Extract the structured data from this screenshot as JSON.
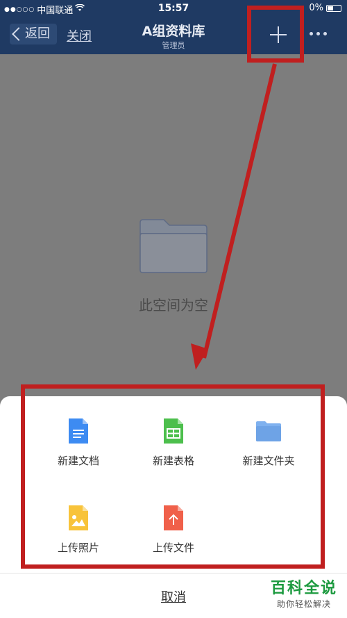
{
  "status_bar": {
    "carrier": "中国联通",
    "time": "15:57",
    "battery": "0%"
  },
  "nav": {
    "back_label": "返回",
    "close_label": "关闭",
    "title": "A组资料库",
    "subtitle": "管理员"
  },
  "content": {
    "empty_text": "此空间为空"
  },
  "sheet": {
    "items": [
      {
        "label": "新建文档",
        "icon": "doc-icon"
      },
      {
        "label": "新建表格",
        "icon": "sheet-icon"
      },
      {
        "label": "新建文件夹",
        "icon": "folder-icon"
      },
      {
        "label": "上传照片",
        "icon": "photo-icon"
      },
      {
        "label": "上传文件",
        "icon": "upload-icon"
      }
    ],
    "cancel_label": "取消"
  },
  "colors": {
    "nav_bg": "#1f3a63",
    "annotation": "#c01f1f",
    "doc_blue": "#3d8bf2",
    "sheet_green": "#4cbf4c",
    "folder_blue": "#7fb1ef",
    "photo_yellow": "#f8c33a",
    "upload_red": "#f0604a"
  },
  "watermark": {
    "title": "百科全说",
    "subtitle": "助你轻松解决"
  }
}
